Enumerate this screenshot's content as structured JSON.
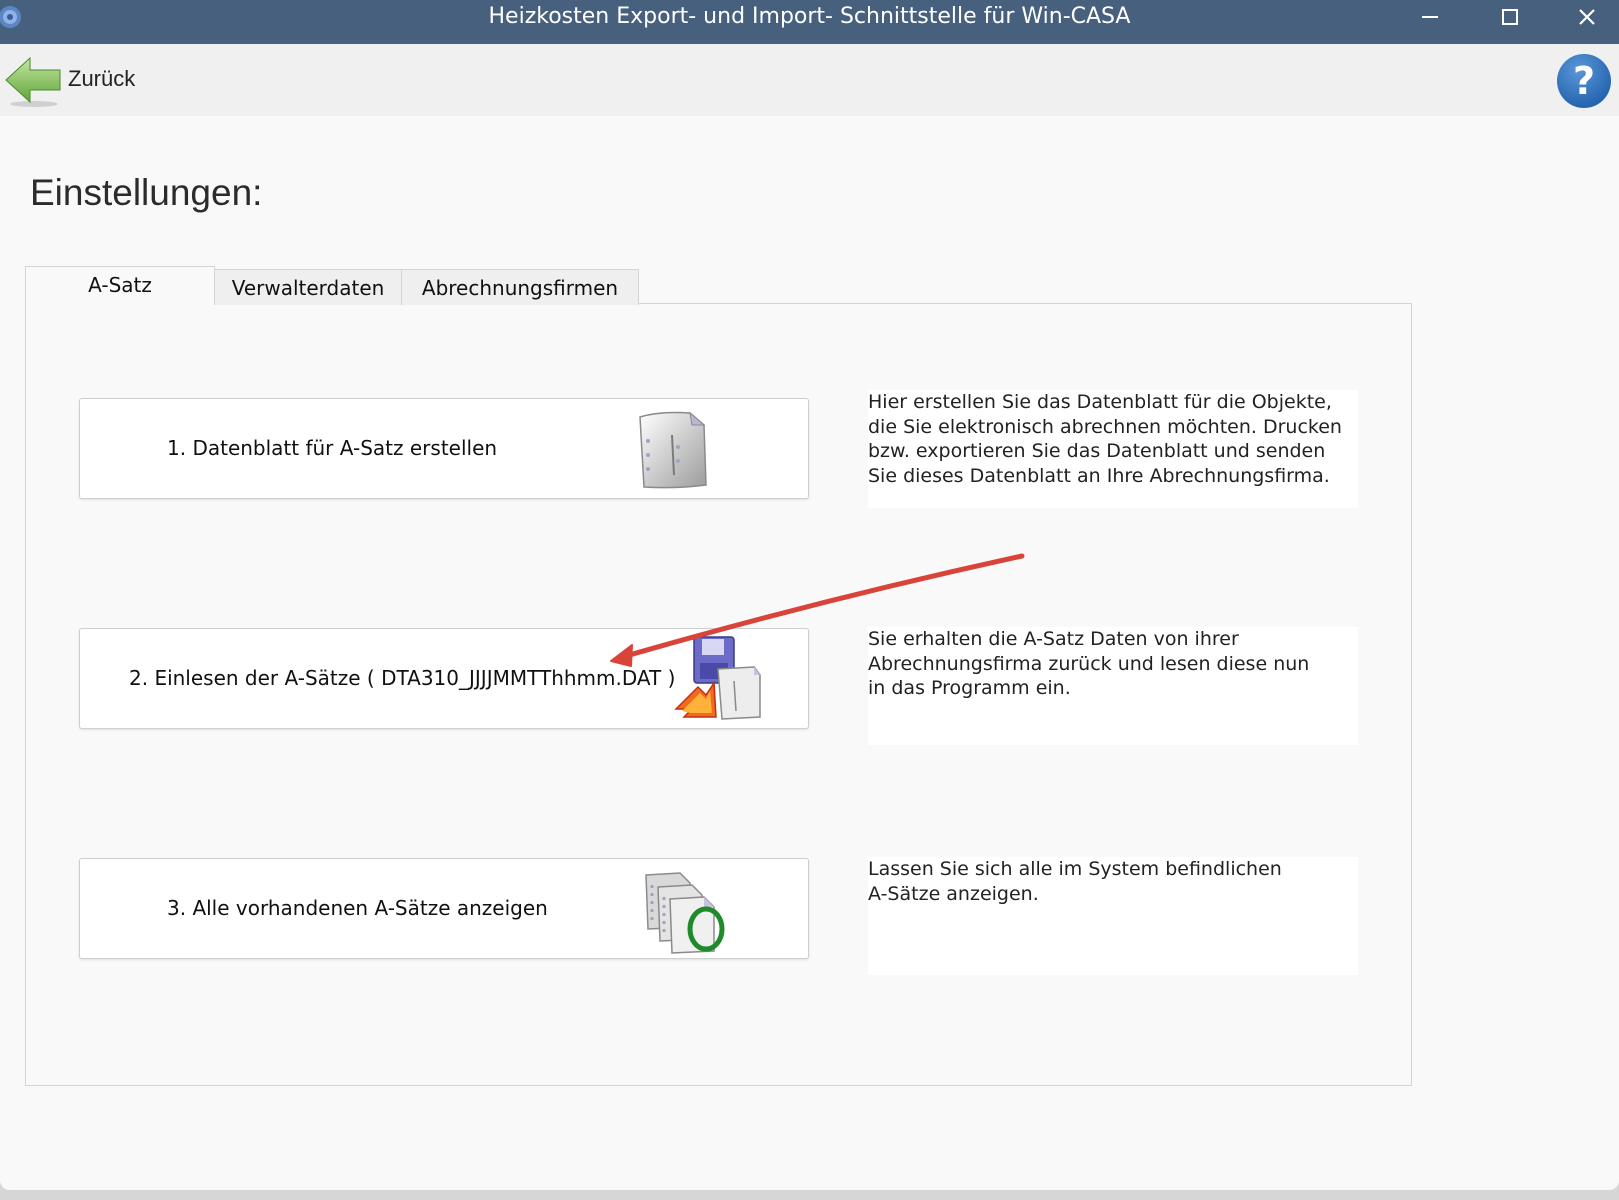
{
  "window": {
    "title": "Heizkosten Export- und Import- Schnittstelle für Win-CASA"
  },
  "toolbar": {
    "back_label": "Zurück",
    "help_icon": "help-icon"
  },
  "page": {
    "title": "Einstellungen:"
  },
  "tabs": [
    {
      "label": "A-Satz",
      "active": true
    },
    {
      "label": "Verwalterdaten",
      "active": false
    },
    {
      "label": "Abrechnungsfirmen",
      "active": false
    }
  ],
  "actions": [
    {
      "label": "1.  Datenblatt für A-Satz erstellen",
      "icon": "datasheet-icon",
      "description": [
        "Hier erstellen Sie das Datenblatt für die Objekte,",
        "die Sie elektronisch abrechnen möchten. Drucken",
        "bzw. exportieren Sie das Datenblatt und senden",
        "Sie dieses Datenblatt an Ihre Abrechnungsfirma."
      ]
    },
    {
      "label": "2.  Einlesen der A-Sätze ( DTA310_JJJJMMTThhmm.DAT )",
      "icon": "import-disk-icon",
      "description": [
        "Sie erhalten die A-Satz Daten von ihrer",
        "Abrechnungsfirma zurück und lesen diese nun",
        "in das Programm ein."
      ]
    },
    {
      "label": "3.  Alle vorhandenen A-Sätze anzeigen",
      "icon": "show-records-icon",
      "description": [
        "Lassen Sie sich alle im System befindlichen",
        "A-Sätze anzeigen."
      ]
    }
  ],
  "colors": {
    "titlebar": "#47607e",
    "annotation_arrow": "#d9443a"
  }
}
